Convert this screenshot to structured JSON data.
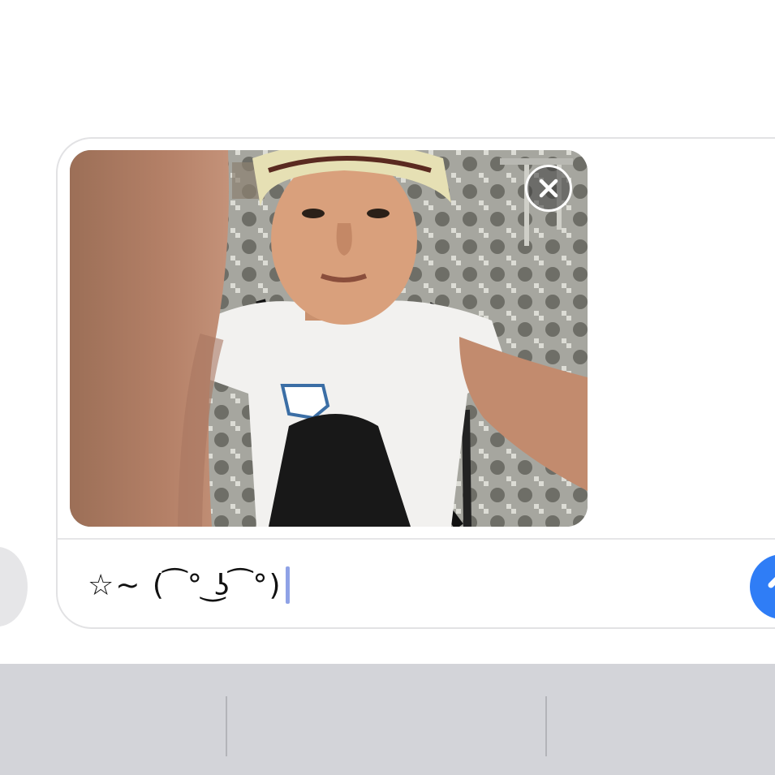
{
  "composer": {
    "attachment": {
      "kind": "photo",
      "description_icon": "selfie-photo",
      "remove_icon": "close-icon"
    },
    "message_text": "☆~ ( ͡ ° ͜ʖ ͡ °)",
    "send_icon": "arrow-up-icon"
  },
  "toolbar": {
    "left_button_icon": "app-drawer-icon"
  },
  "colors": {
    "send_button": "#2f7df6",
    "caret": "#8fa2e6",
    "keyboard_background": "#d3d4d9",
    "composer_border": "#e2e2e4"
  }
}
